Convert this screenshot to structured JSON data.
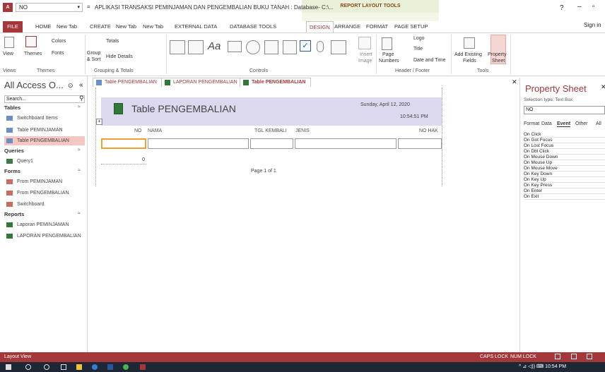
{
  "titlebar": {
    "object_selector": "NO",
    "title": "APLIKASI TRANSAKSI PEMINJAMAN DAN PENGEMBALIAN BUKU TANAH : Database- C:\\...",
    "context_label": "REPORT LAYOUT TOOLS",
    "help": "?",
    "sign_in": "Sign in"
  },
  "ribbon_tabs": [
    "FILE",
    "HOME",
    "New Tab",
    "CREATE",
    "New Tab",
    "New Tab",
    "EXTERNAL DATA",
    "DATABASE TOOLS",
    "DESIGN",
    "ARRANGE",
    "FORMAT",
    "PAGE SETUP"
  ],
  "active_tab": "DESIGN",
  "ribbon": {
    "view": "View",
    "themes": "Themes",
    "colors": "Colors",
    "fonts": "Fonts",
    "group": "Group",
    "sort": "& Sort",
    "totals": "Totals",
    "hide_details": "Hide Details",
    "insert_image": "Insert",
    "image": "Image",
    "page": "Page",
    "numbers": "Numbers",
    "logo": "Logo",
    "title": "Title",
    "date_time": "Date and Time",
    "add_existing": "Add Existing",
    "fields": "Fields",
    "property": "Property",
    "sheet": "Sheet",
    "groups": {
      "views": "Views",
      "themes": "Themes",
      "grouping": "Grouping & Totals",
      "controls": "Controls",
      "header_footer": "Header / Footer",
      "tools": "Tools"
    }
  },
  "nav": {
    "title": "All Access O...",
    "search_placeholder": "Search...",
    "categories": [
      {
        "name": "Tables",
        "items": [
          "Switchboard Items",
          "Table PEMINJAMAN",
          "Table PENGEMBALIAN"
        ]
      },
      {
        "name": "Queries",
        "items": [
          "Query1"
        ]
      },
      {
        "name": "Forms",
        "items": [
          "From PEMINJAMAN",
          "From PENGEMBALIAN",
          "Switchboard"
        ]
      },
      {
        "name": "Reports",
        "items": [
          "Laporan PEMINJAMAN",
          "LAPORAN PENGEMBALIAN"
        ]
      }
    ],
    "selected": "Table PENGEMBALIAN"
  },
  "doc_tabs": [
    "Table PENGEMBALIAN",
    "LAPORAN PENGEMBALIAN",
    "Table PENGEMBALIAN"
  ],
  "active_doc_tab": 2,
  "report": {
    "title": "Table PENGEMBALIAN",
    "date": "Sunday, April 12, 2020",
    "time": "10:54:51 PM",
    "columns": [
      "NO",
      "NAMA",
      "TGL KEMBALI",
      "JENIS",
      "NO HAK"
    ],
    "count": "0",
    "page": "Page 1 of 1"
  },
  "property_sheet": {
    "title": "Property Sheet",
    "selection_type": "Selection type: Text Box",
    "selected": "NO",
    "tabs": [
      "Format",
      "Data",
      "Event",
      "Other",
      "All"
    ],
    "active_tab": "Event",
    "rows": [
      "On Click",
      "On Got Focus",
      "On Lost Focus",
      "On Dbl Click",
      "On Mouse Down",
      "On Mouse Up",
      "On Mouse Move",
      "On Key Down",
      "On Key Up",
      "On Key Press",
      "On Enter",
      "On Exit"
    ]
  },
  "status": {
    "left": "Layout View",
    "caps": "CAPS LOCK",
    "num": "NUM LOCK"
  },
  "taskbar": {
    "clock": "10:54 PM"
  },
  "colors": {
    "accent": "#a4373a",
    "report_header": "#dcd8ee",
    "selected_nav": "#f4c7c3"
  }
}
